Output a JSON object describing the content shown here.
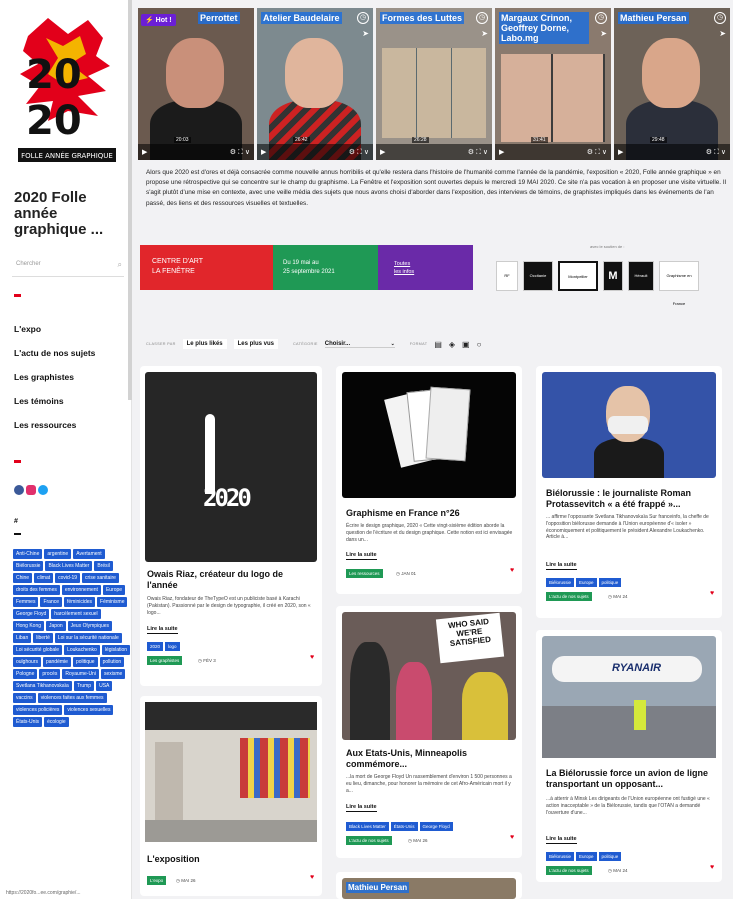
{
  "sidebar": {
    "site_title": "2020 Folle année graphique ...",
    "logo_text": "FOLLE ANNÉE GRAPHIQUE",
    "search_placeholder": "Chercher",
    "nav": [
      "L'expo",
      "L'actu de nos sujets",
      "Les graphistes",
      "Les témoins",
      "Les ressources"
    ],
    "hash": "#",
    "tags": [
      "Anti-Chine",
      "argentine",
      "Avertament",
      "Biélorussie",
      "Black Lives Matter",
      "Brésil",
      "Chine",
      "climat",
      "covid-19",
      "crise sanitaire",
      "droits des femmes",
      "environnement",
      "Europe",
      "Femmes",
      "France",
      "féminicides",
      "Féminisme",
      "George Floyd",
      "harcèlement sexuel",
      "Hong Kong",
      "Japon",
      "Jeux Olympiques",
      "Liban",
      "liberté",
      "Loi sur la sécurité nationale",
      "Loi sécurité globale",
      "Loukachenko",
      "législation",
      "oulghours",
      "pandémie",
      "politique",
      "pollution",
      "Pologne",
      "procès",
      "Royaume-Uni",
      "sexisme",
      "Svetlana Tikhanovskaïa",
      "Trump",
      "USA",
      "vaccins",
      "violences faites aux femmes",
      "violences policières",
      "violences sexuelles",
      "États-Unis",
      "écologie"
    ],
    "status_url": "https://2020fo...ee.com/graphie/...",
    "colors": {
      "accent": "#e2001a",
      "tag_blue": "#1f5bd1",
      "green": "#1f9955",
      "purple": "#6b1fd6"
    }
  },
  "videos": {
    "hot_label": "Hot !",
    "items": [
      {
        "title": "Perrottet",
        "time": "20:03"
      },
      {
        "title": "Atelier Baudelaire",
        "time": "26:42"
      },
      {
        "title": "Formes des Luttes",
        "time": "26:28"
      },
      {
        "title": "Margaux Crinon, Geoffrey Dorne, Labo.mg",
        "time": "31:41"
      },
      {
        "title": "Mathieu Persan",
        "time": "29:48"
      }
    ]
  },
  "intro": "Alors que 2020 est d'ores et déjà consacrée comme nouvelle annus horribilis et qu'elle restera dans l'histoire de l'humanité comme l'année de la pandémie, l'exposition « 2020, Folle année graphique » en propose une rétrospective qui se concentre sur le champ du graphisme. La Fenêtre et l'exposition sont ouvertes depuis le mercredi 19 MAI 2020. Ce site n'a pas vocation à en proposer une visite virtuelle. Il s'agit plutôt d'une mise en contexte, avec une veille média des sujets que nous avons choisi d'aborder dans l'exposition, des interviews de témoins, de graphistes impliqués dans les événements de l'an passé, des liens et des ressources visuelles et textuelles.",
  "banner": {
    "venue_line1": "CENTRE D'ART",
    "venue_line2": "LA FENÊTRE",
    "dates_line1": "Du 19 mai au",
    "dates_line2": "25 septembre 2021",
    "info_line1": "Toutes",
    "info_line2": "les infos",
    "partners_label": "avec le soutien de :",
    "partners": [
      "RF",
      "Occitanie",
      "Montpellier",
      "M",
      "Hérault",
      "Graphisme en France"
    ]
  },
  "filters": {
    "sort_label": "CLASSER PAR",
    "sort_liked": "Le plus likés",
    "sort_viewed": "Les plus vus",
    "category_label": "CATÉGORIE",
    "category_value": "Choisir...",
    "format_label": "FORMAT"
  },
  "cards": [
    {
      "title": "Owais Riaz, créateur du logo de l'année",
      "excerpt": "Owais Riaz, fondateur de TheTypeO est un publiciste basé à Karachi (Pakistan). Passionné par le design de typographie, il créé en 2020, son « logo...",
      "more": "Lire la suite",
      "tags": [
        "2020",
        "logo"
      ],
      "category": "Les graphistes",
      "date": "FÉV 3",
      "image_text": "2020"
    },
    {
      "title": "L'exposition",
      "excerpt": "",
      "more": "",
      "tags": [],
      "category": "L'expo",
      "date": "MAI 26"
    },
    {
      "title": "Graphisme en France n°26",
      "excerpt": "Écrire le design graphique, 2020 « Cette vingt-sixième édition aborde la question de l'écriture et du design graphique. Cette notion est ici envisagée dans un...",
      "more": "Lire la suite",
      "tags": [],
      "category": "Les ressources",
      "date": "JAN 01"
    },
    {
      "title": "Aux Etats-Unis, Minneapolis commémore...",
      "excerpt": "...la mort de George Floyd Un rassemblement d'environ 1 500 personnes a eu lieu, dimanche, pour honorer la mémoire de cet Afro-Américain mort il y a...",
      "more": "Lire la suite",
      "tags": [
        "Black Lives Matter",
        "États-Unis",
        "George Floyd"
      ],
      "category": "L'actu de nos sujets",
      "date": "MAI 26",
      "image_text": "WHO SAID WE'RE SATISFIED"
    },
    {
      "title": "Mathieu Persan",
      "excerpt": "",
      "more": "",
      "tags": [],
      "category": "",
      "date": ""
    },
    {
      "title": "Biélorussie : le journaliste Roman Protassevitch « a été frappé »...",
      "excerpt": "... affirme l'opposante Svetlana Tikhanovskaïa Sur franceinfo, la cheffe de l'opposition biélorusse demande à l'Union européenne d'« isoler » économiquement et politiquement le président Alexandre Loukachenko. Article à...",
      "more": "Lire la suite",
      "tags": [
        "Biélorussie",
        "Europe",
        "politique"
      ],
      "category": "L'actu de nos sujets",
      "date": "MAI 24"
    },
    {
      "title": "La Biélorussie force un avion de ligne transportant un opposant...",
      "excerpt": "...à atterrir à Minsk Les dirigeants de l'Union européenne ont fustigé une « action inacceptable » de la Biélorussie, tandis que l'OTAN a demandé l'ouverture d'une...",
      "more": "Lire la suite",
      "tags": [
        "Biélorussie",
        "Europe",
        "politique"
      ],
      "category": "L'actu de nos sujets",
      "date": "MAI 24",
      "image_text": "RYANAIR"
    }
  ]
}
